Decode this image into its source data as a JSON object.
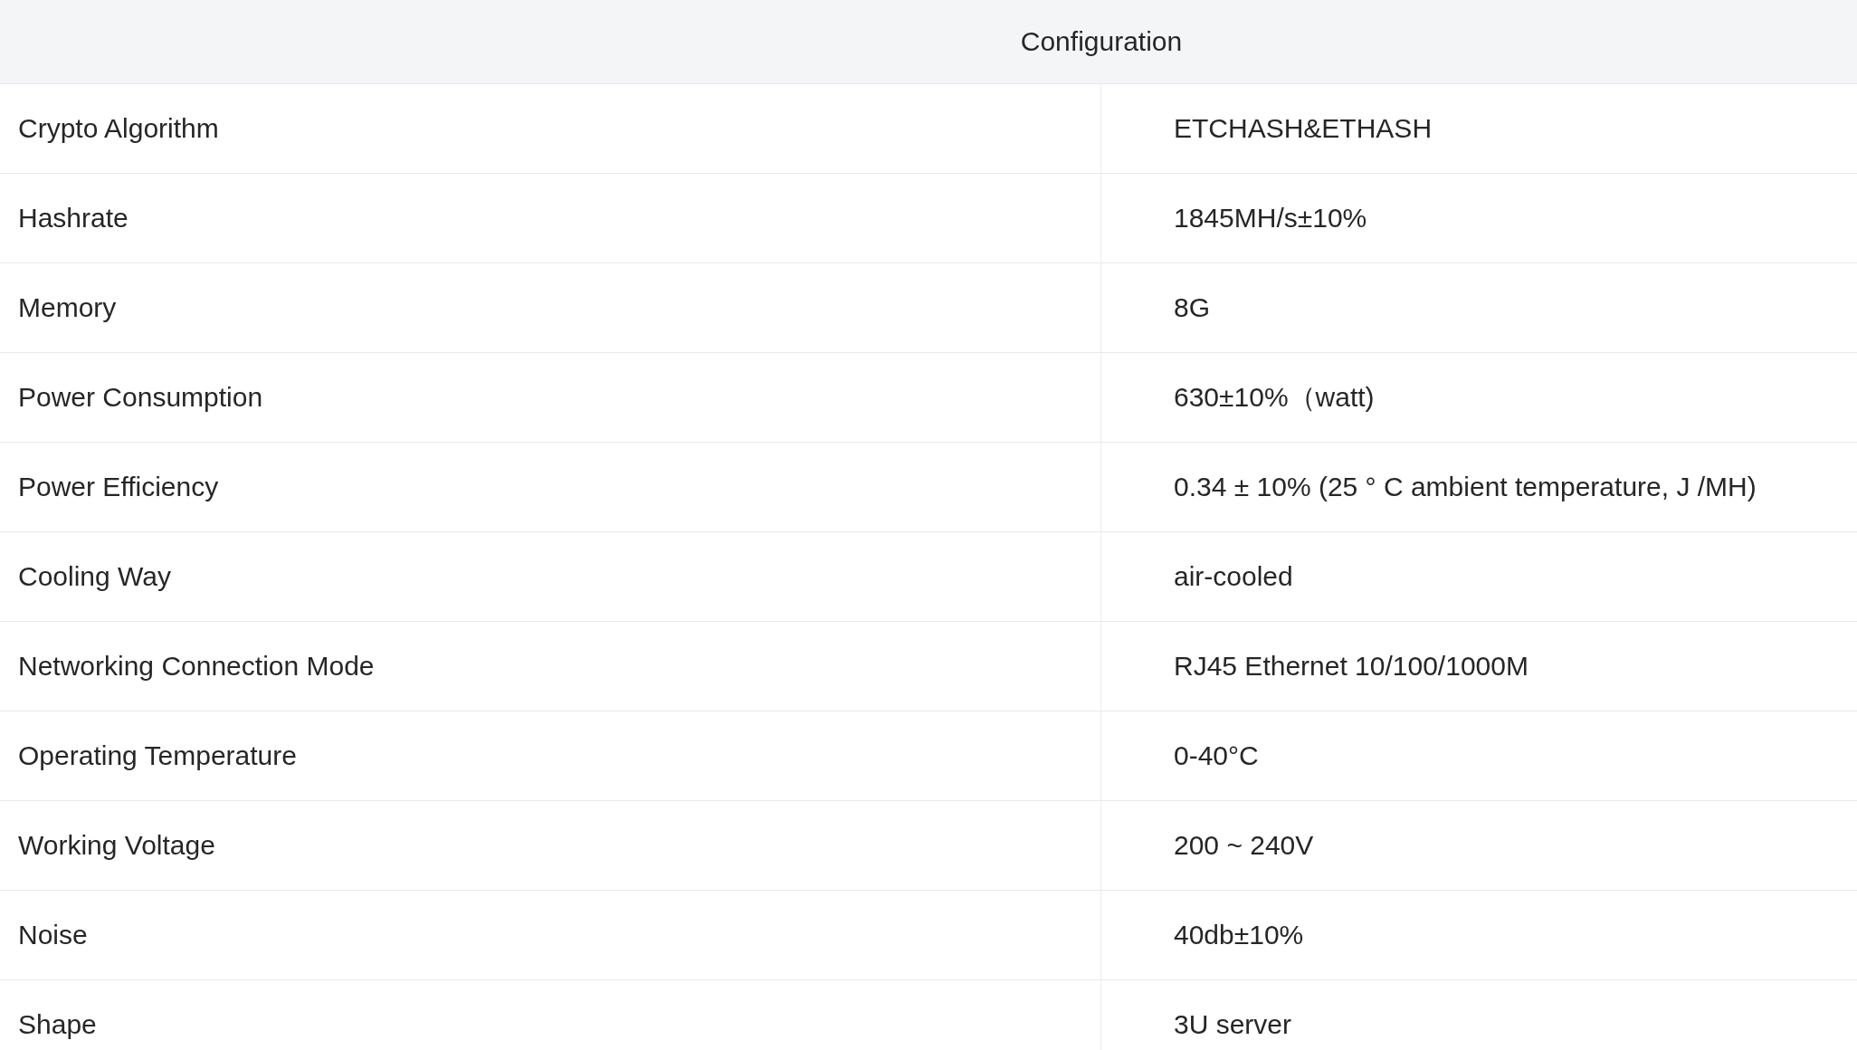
{
  "table": {
    "header": "Configuration",
    "rows": [
      {
        "label": "Crypto Algorithm",
        "value": "ETCHASH&ETHASH"
      },
      {
        "label": "Hashrate",
        "value": "1845MH/s±10%"
      },
      {
        "label": "Memory",
        "value": "8G"
      },
      {
        "label": "Power Consumption",
        "value": "630±10%（watt)"
      },
      {
        "label": "Power Efficiency",
        "value": "0.34 ± 10% (25 ° C ambient temperature, J /MH)"
      },
      {
        "label": "Cooling Way",
        "value": "air-cooled"
      },
      {
        "label": "Networking Connection Mode",
        "value": "RJ45 Ethernet 10/100/1000M"
      },
      {
        "label": "Operating Temperature",
        "value": "0-40°C"
      },
      {
        "label": "Working Voltage",
        "value": "200 ~ 240V"
      },
      {
        "label": "Noise",
        "value": "40db±10%"
      },
      {
        "label": "Shape",
        "value": "3U server"
      }
    ]
  }
}
